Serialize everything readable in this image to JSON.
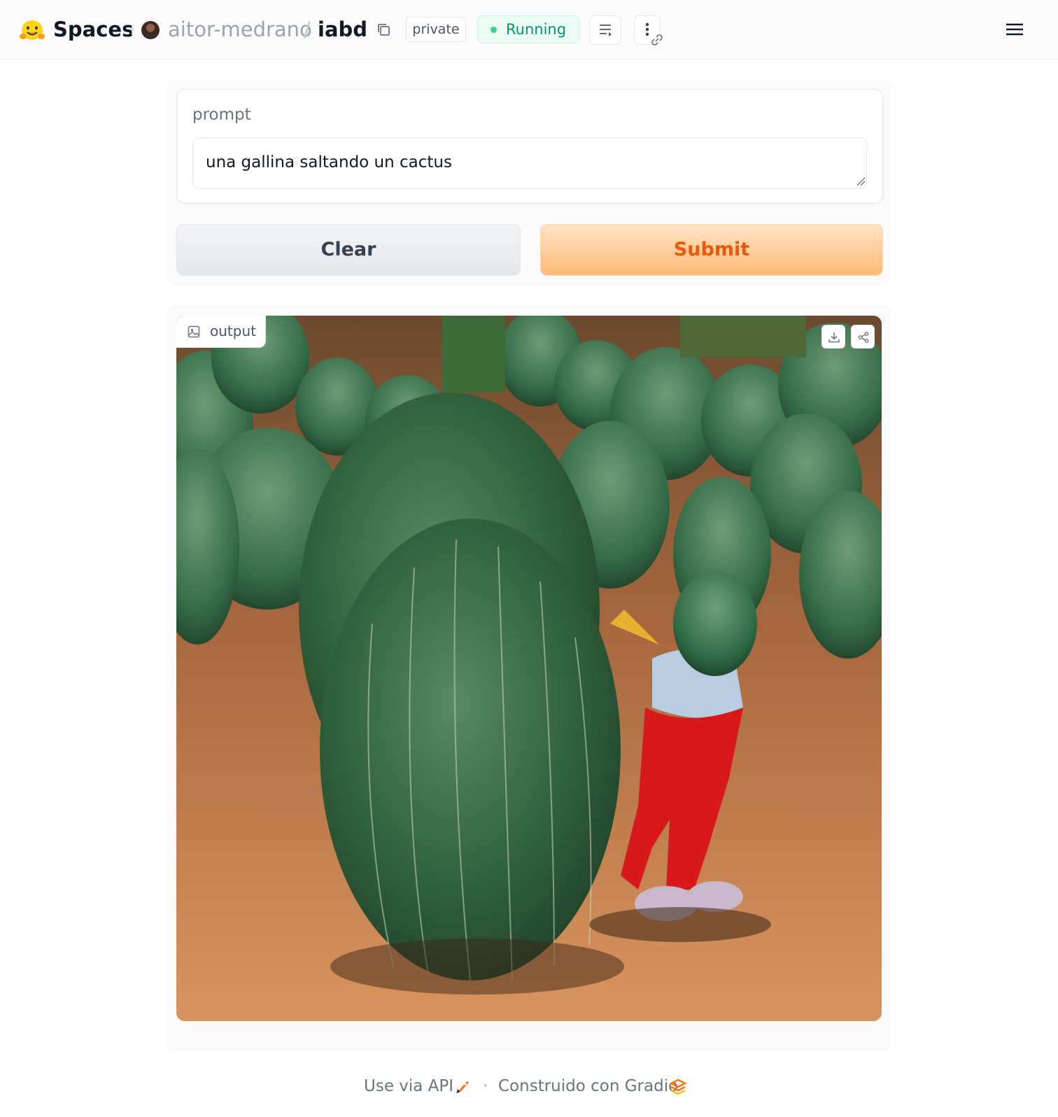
{
  "header": {
    "brand": "Spaces",
    "owner": "aitor-medrano",
    "separator": "/",
    "repo": "iabd",
    "visibility_badge": "private",
    "status_badge": "Running",
    "status_color": "#10b981"
  },
  "form": {
    "prompt_label": "prompt",
    "prompt_value": "una gallina saltando un cactus",
    "clear_label": "Clear",
    "submit_label": "Submit",
    "accent_color": "#f97316"
  },
  "output": {
    "label": "output",
    "image_description_icon": "image-icon"
  },
  "footer": {
    "api_label": "Use via API",
    "dot": "·",
    "built_label": "Construido con Gradio"
  }
}
